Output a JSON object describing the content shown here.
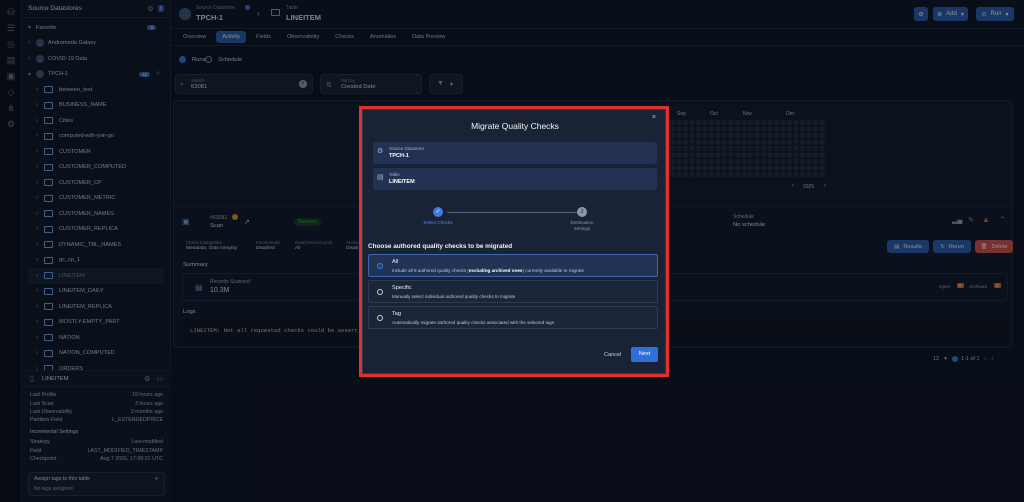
{
  "sidebar": {
    "title": "Source Datastores",
    "favorite_label": "Favorite",
    "favorite_count": "3",
    "datastores": [
      {
        "label": "Andromeda Galaxy"
      },
      {
        "label": "COVID-19 Data"
      },
      {
        "label": "TPCH-1",
        "badge": "42"
      }
    ],
    "tables": [
      "between_test",
      "BUSINESS_NAME",
      "Cities",
      "computed-with-join-go",
      "CUSTOMER",
      "CUSTOMER_COMPUTED",
      "CUSTOMER_CP",
      "CUSTOMER_METRIC",
      "CUSTOMER_NAMES",
      "CUSTOMER_REPLICA",
      "DYNAMIC_TBL_NAMES",
      "gc_cp_1",
      "LINEITEM",
      "LINEITEM_DAILY",
      "LINEITEM_REPLICA",
      "MOSTLY-EMPTY_PART",
      "NATION",
      "NATION_COMPUTED",
      "ORDERS"
    ],
    "selected_table": "LINEITEM"
  },
  "details": {
    "title": "LINEITEM",
    "rows": [
      {
        "k": "Last Profile",
        "v": "19 hours ago"
      },
      {
        "k": "Last Scan",
        "v": "3 hours ago"
      },
      {
        "k": "Last Observability",
        "v": "2 months ago"
      },
      {
        "k": "Partition Field",
        "v": "L_EXTENDEDPRICE"
      }
    ],
    "incremental_title": "Incremental Settings",
    "inc_rows": [
      {
        "k": "Strategy",
        "v": "Last-modified"
      },
      {
        "k": "Field",
        "v": "LAST_MODIFIED_TIMESTAMP"
      },
      {
        "k": "Checkpoint",
        "v": "Aug 7 2025, 17:00:21 UTC"
      }
    ],
    "tags_title": "Assign tags to this table",
    "tags_empty": "No tags assigned"
  },
  "topbar": {
    "datastore_label": "Source Datastore",
    "datastore_value": "TPCH-1",
    "table_label": "Table",
    "table_value": "LINEITEM",
    "add_label": "Add",
    "run_label": "Run"
  },
  "tabs": [
    "Overview",
    "Activity",
    "Fields",
    "Observability",
    "Checks",
    "Anomalies",
    "Data Preview"
  ],
  "active_tab": "Activity",
  "activity": {
    "runs_label": "Runs",
    "schedule_label": "Schedule",
    "search_label": "Search",
    "search_value": "63081",
    "sort_label": "Sort by",
    "sort_value": "Created Date",
    "months": [
      "Sep",
      "Oct",
      "Nov",
      "Dec"
    ],
    "year": "2025",
    "scan_id": "#63081",
    "scan_type": "Scan",
    "scan_status": "Success",
    "schedule_title": "Schedule",
    "schedule_value": "No schedule",
    "check_categories_label": "Check Categories",
    "check_categories_value": "Metadata, Data Integrity",
    "incremental_label": "Incremental",
    "incremental_value": "Disabled",
    "read_limit_label": "Read Record Limit",
    "read_limit_value": "All",
    "archive_label": "Archive",
    "archive_value": "Disab",
    "results_label": "Results",
    "rerun_label": "Rerun",
    "delete_label": "Delete",
    "summary_label": "Summary",
    "records_label": "Records Scanned",
    "records_value": "10.3M",
    "open_label": "Open",
    "open_count": "0",
    "archived_label": "Archived",
    "archived_count": "0",
    "logs_label": "Logs",
    "log_line": "LINEITEM: Not all requested checks could be assert",
    "per_page": "12",
    "pagination": "1-1 of 1"
  },
  "modal": {
    "title": "Migrate Quality Checks",
    "datastore_label": "Source Datastore",
    "datastore_value": "TPCH-1",
    "table_label": "Table",
    "table_value": "LINEITEM",
    "step1": "Select Checks",
    "step2_num": "2",
    "step2": "Destination Settings",
    "question": "Choose authored quality checks to be migrated",
    "options": [
      {
        "title": "All",
        "desc_pre": "Include all 6 authored quality checks (",
        "desc_bold": "excluding archived ones",
        "desc_post": ") currently available to migrate"
      },
      {
        "title": "Specific",
        "desc": "Manually select individual authored quality checks to migrate"
      },
      {
        "title": "Tag",
        "desc": "Automatically migrate authored quality checks associated with the selected tags"
      }
    ],
    "cancel_label": "Cancel",
    "next_label": "Next"
  },
  "colors": {
    "accent": "#2f62b3",
    "highlight_border": "#e0312a",
    "delete": "#d9534f",
    "success": "#3cb55a"
  }
}
